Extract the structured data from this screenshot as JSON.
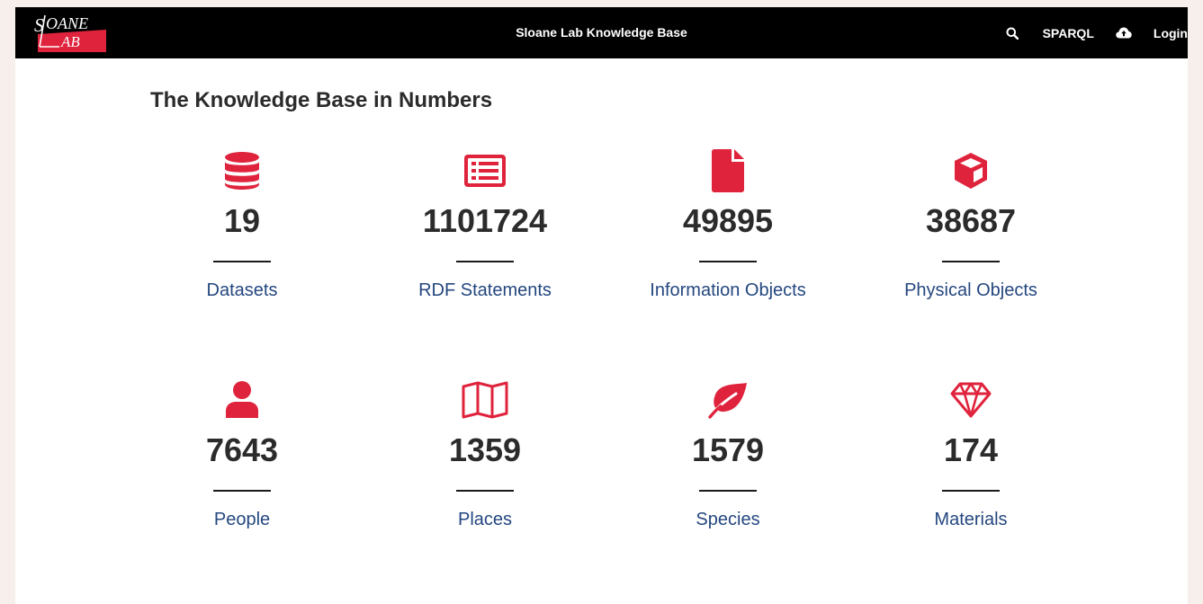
{
  "colors": {
    "accent": "#e0233c",
    "link": "#24477f",
    "navbar": "#000000"
  },
  "navbar": {
    "logo_alt": "Sloane Lab",
    "title": "Sloane Lab Knowledge Base",
    "search_icon": "search-icon",
    "sparql_label": "SPARQL",
    "cloud_icon": "cloud-upload-icon",
    "login_label": "Login"
  },
  "main": {
    "title": "The Knowledge Base in Numbers",
    "stats": [
      {
        "icon": "database-icon",
        "value": "19",
        "label": "Datasets"
      },
      {
        "icon": "list-alt-icon",
        "value": "1101724",
        "label": "RDF Statements"
      },
      {
        "icon": "file-icon",
        "value": "49895",
        "label": "Information Objects"
      },
      {
        "icon": "cube-icon",
        "value": "38687",
        "label": "Physical Objects"
      },
      {
        "icon": "user-icon",
        "value": "7643",
        "label": "People"
      },
      {
        "icon": "map-icon",
        "value": "1359",
        "label": "Places"
      },
      {
        "icon": "leaf-icon",
        "value": "1579",
        "label": "Species"
      },
      {
        "icon": "gem-icon",
        "value": "174",
        "label": "Materials"
      }
    ]
  }
}
